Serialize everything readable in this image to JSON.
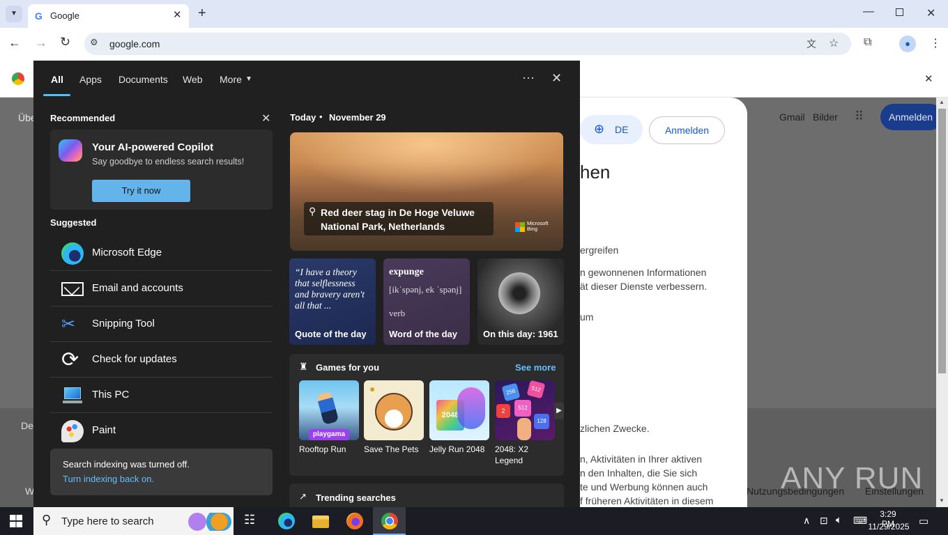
{
  "browser": {
    "tab_title": "Google",
    "url": "google.com"
  },
  "page": {
    "left_link": "Übe",
    "left_link2": "De",
    "left_link3": "W",
    "gmail": "Gmail",
    "images": "Bilder",
    "signin": "Anmelden",
    "bottom_terms": "Nutzungsbedingungen",
    "bottom_settings": "Einstellungen",
    "dialog": {
      "lang": "DE",
      "signin": "Anmelden",
      "title": "hen",
      "line1": "ergreifen",
      "line2": "n gewonnenen Informationen",
      "line3": "ät dieser Dienste verbessern.",
      "line4": "um",
      "line5": "zlichen Zwecke.",
      "line6": "n, Aktivitäten in Ihrer aktiven",
      "line7": "n den Inhalten, die Sie sich",
      "line8": "te und Werbung können auch",
      "line9": "f früheren Aktivitäten in diesem"
    }
  },
  "start_panel": {
    "tabs": [
      "All",
      "Apps",
      "Documents",
      "Web",
      "More"
    ],
    "recommended_label": "Recommended",
    "copilot": {
      "title": "Your AI-powered Copilot",
      "subtitle": "Say goodbye to endless search results!",
      "button": "Try it now"
    },
    "suggested_label": "Suggested",
    "suggested": [
      {
        "label": "Microsoft Edge",
        "icon": "edge-icon"
      },
      {
        "label": "Email and accounts",
        "icon": "mail-icon"
      },
      {
        "label": "Snipping Tool",
        "icon": "snipping-tool-icon"
      },
      {
        "label": "Check for updates",
        "icon": "refresh-icon"
      },
      {
        "label": "This PC",
        "icon": "computer-icon"
      },
      {
        "label": "Paint",
        "icon": "paint-icon"
      }
    ],
    "indexing": {
      "text": "Search indexing was turned off.",
      "link": "Turn indexing back on."
    },
    "today": {
      "label": "Today",
      "date": "November 29",
      "hero_caption": "Red deer stag in De Hoge Veluwe National Park, Netherlands",
      "brand": "Microsoft Bing"
    },
    "tiles": {
      "quote_text": "“I have a theory that selflessness and bravery aren't all that ...",
      "quote_caption": "Quote of the day",
      "word": "expunge",
      "word_pron": "[ikˈspənj, ek ˈspənj]",
      "word_pos": "verb",
      "word_caption": "Word of the day",
      "history_caption": "On this day: 1961"
    },
    "games": {
      "label": "Games for you",
      "see_more": "See more",
      "items": [
        "Rooftop Run",
        "Save The Pets",
        "Jelly Run 2048",
        "2048: X2 Legend"
      ],
      "badge": "playgama"
    },
    "trending": "Trending searches"
  },
  "taskbar": {
    "search_placeholder": "Type here to search",
    "time": "3:29 PM",
    "date": "11/29/2025"
  },
  "watermark": "ANY RUN"
}
